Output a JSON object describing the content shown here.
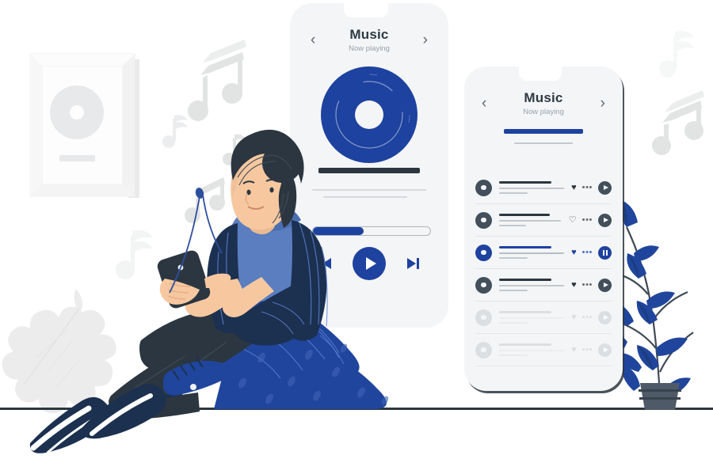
{
  "illustration": {
    "name": "music-listening-illustration",
    "description": "Woman sitting with phone listening to music beside two mobile music player screens"
  },
  "colors": {
    "brand_blue": "#1e429f",
    "deep_navy": "#1c3050",
    "dark_slate": "#2b3640",
    "screen_bg": "#f4f5f6",
    "muted_text": "#98a2aa",
    "line_gray": "#b9c0c6",
    "leaf_blue": "#20459c",
    "skin": "#f7c8a0",
    "shirt_blue": "#5a7ec0",
    "note_gray": "#e2e4e4",
    "frame_white": "#fbfbfb"
  },
  "phone_player": {
    "name": "music-player-screen",
    "nav": {
      "prev_icon": "chevron-left-icon",
      "next_icon": "chevron-right-icon",
      "prev_label": "‹",
      "next_label": "›"
    },
    "title": "Music",
    "subtitle": "Now playing",
    "album_art": {
      "icon": "vinyl-record-icon",
      "color": "#1e429f"
    },
    "progress": {
      "percent": 43,
      "percent_label": "43%"
    },
    "controls": {
      "previous_label": "previous-track",
      "play_label": "play",
      "next_label": "next-track"
    }
  },
  "phone_playlist": {
    "name": "music-playlist-screen",
    "nav": {
      "prev_label": "‹",
      "next_label": "›"
    },
    "title": "Music",
    "subtitle": "Now playing",
    "rows": [
      {
        "state": "normal",
        "liked": true,
        "action": "play",
        "heart_glyph": "♥",
        "dots_glyph": "•••"
      },
      {
        "state": "normal",
        "liked": false,
        "action": "play",
        "heart_glyph": "♡",
        "dots_glyph": "•••"
      },
      {
        "state": "active",
        "liked": true,
        "action": "pause",
        "heart_glyph": "♥",
        "dots_glyph": "•••"
      },
      {
        "state": "normal",
        "liked": true,
        "action": "play",
        "heart_glyph": "♥",
        "dots_glyph": "•••"
      },
      {
        "state": "disabled",
        "liked": true,
        "action": "play",
        "heart_glyph": "♥",
        "dots_glyph": "•••"
      },
      {
        "state": "disabled",
        "liked": true,
        "action": "play",
        "heart_glyph": "♥",
        "dots_glyph": "•••"
      }
    ]
  },
  "scene": {
    "picture_frame": {
      "name": "framed-vinyl-poster",
      "art_icon": "vinyl-record-icon"
    },
    "person": {
      "name": "woman-with-phone",
      "holding": "smartphone",
      "wearing": "earbuds"
    },
    "plant": {
      "name": "potted-plant"
    },
    "leaf": {
      "name": "oak-leaf-decoration"
    },
    "music_notes_count": 7
  }
}
